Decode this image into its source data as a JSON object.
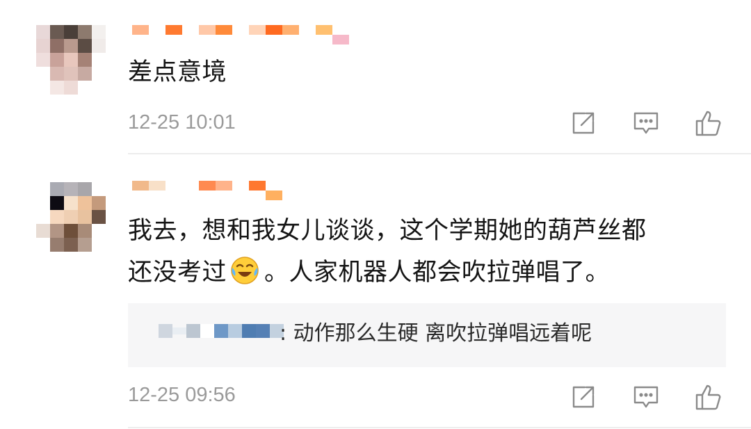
{
  "comments": [
    {
      "text": "差点意境",
      "time": "12-25 10:01",
      "icons": [
        "share-icon",
        "comment-icon",
        "like-icon"
      ]
    },
    {
      "text_line1": "我去，想和我女儿谈谈，这个学期她的葫芦丝都",
      "text_line2_before": "还没考过",
      "emoji": "laughing-crying-emoji",
      "text_line2_after": "。人家机器人都会吹拉弹唱了。",
      "reply": {
        "text": ": 动作那么生硬 离吹拉弹唱远着呢"
      },
      "time": "12-25 09:56",
      "icons": [
        "share-icon",
        "comment-icon",
        "like-icon"
      ]
    }
  ],
  "colors": {
    "text": "#151515",
    "meta": "#9a9a9a",
    "divider": "#ededed",
    "reply_bg": "#f6f6f7",
    "accent": "#ff8240"
  }
}
